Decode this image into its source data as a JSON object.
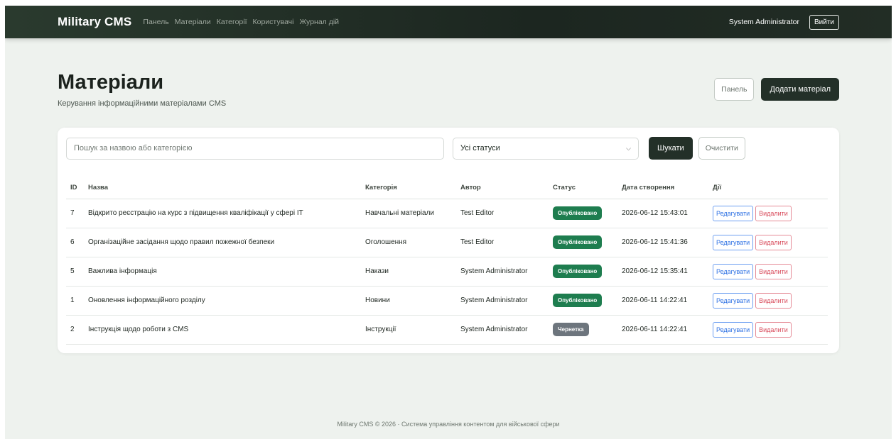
{
  "navbar": {
    "brand": "Military CMS",
    "links": [
      "Панель",
      "Матеріали",
      "Категорії",
      "Користувачі",
      "Журнал дій"
    ],
    "user": "System Administrator",
    "login_label": "Вийти"
  },
  "header": {
    "title": "Матеріали",
    "subtitle": "Керування інформаційними матеріалами CMS",
    "dashboard_button": "Панель",
    "add_button": "Додати матеріал"
  },
  "filters": {
    "search_placeholder": "Пошук за назвою або категорією",
    "status_selected": "Усі статуси",
    "search_button": "Шукати",
    "clear_button": "Очистити"
  },
  "table": {
    "headers": [
      "ID",
      "Назва",
      "Категорія",
      "Автор",
      "Статус",
      "Дата створення",
      "Дії"
    ],
    "rows": [
      {
        "id": "7",
        "title": "Відкрито реєстрацію на курс з підвищення кваліфікації у сфері IT",
        "category": "Навчальні матеріали",
        "author": "Test Editor",
        "status": "Опубліковано",
        "status_type": "published",
        "date": "2026-06-12 15:43:01"
      },
      {
        "id": "6",
        "title": "Організаційне засідання щодо правил пожежної безпеки",
        "category": "Оголошення",
        "author": "Test Editor",
        "status": "Опубліковано",
        "status_type": "published",
        "date": "2026-06-12 15:41:36"
      },
      {
        "id": "5",
        "title": "Важлива інформація",
        "category": "Накази",
        "author": "System Administrator",
        "status": "Опубліковано",
        "status_type": "published",
        "date": "2026-06-12 15:35:41"
      },
      {
        "id": "1",
        "title": "Оновлення інформаційного розділу",
        "category": "Новини",
        "author": "System Administrator",
        "status": "Опубліковано",
        "status_type": "published",
        "date": "2026-06-11 14:22:41"
      },
      {
        "id": "2",
        "title": "Інструкція щодо роботи з CMS",
        "category": "Інструкції",
        "author": "System Administrator",
        "status": "Чернетка",
        "status_type": "draft",
        "date": "2026-06-11 14:22:41"
      }
    ],
    "edit_label": "Редагувати",
    "delete_label": "Видалити"
  },
  "footer": {
    "text": "Military CMS © 2026 · Система управління контентом для військової сфери"
  }
}
